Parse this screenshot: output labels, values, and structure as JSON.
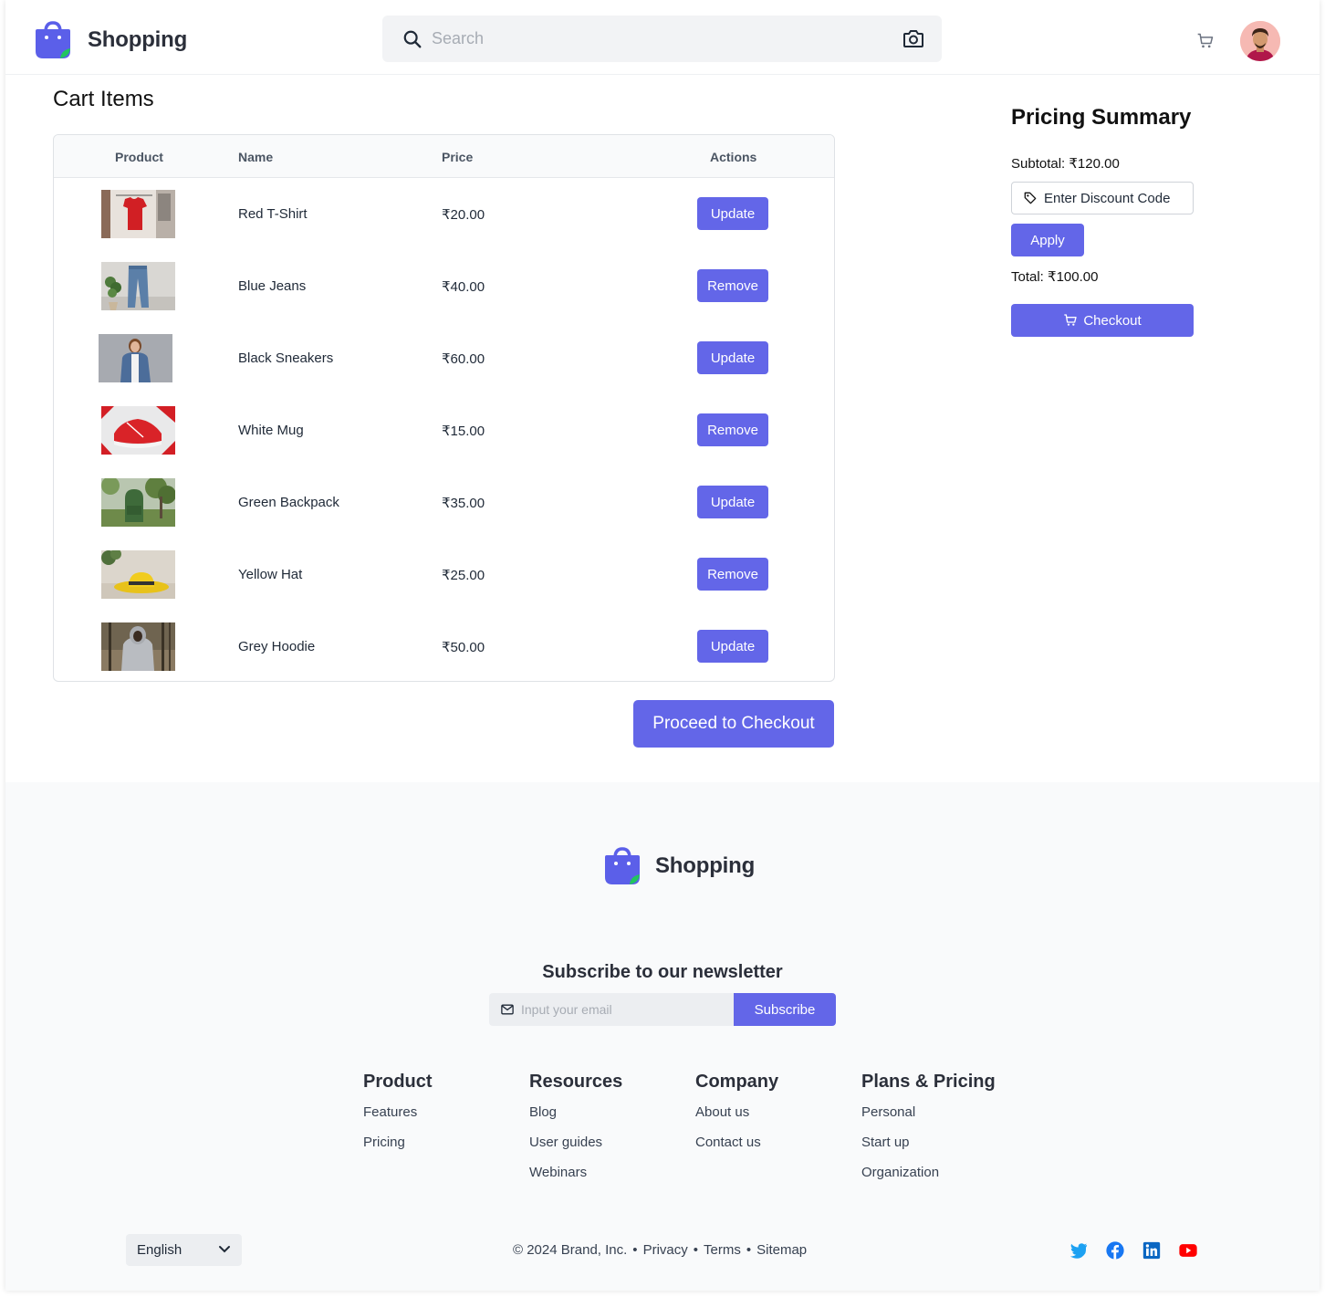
{
  "header": {
    "brand": "Shopping",
    "search_placeholder": "Search"
  },
  "cart": {
    "title": "Cart Items",
    "columns": [
      "Product",
      "Name",
      "Price",
      "Actions"
    ],
    "rows": [
      {
        "name": "Red T-Shirt",
        "price": "₹20.00",
        "action": "Update"
      },
      {
        "name": "Blue Jeans",
        "price": "₹40.00",
        "action": "Remove"
      },
      {
        "name": "Black Sneakers",
        "price": "₹60.00",
        "action": "Update"
      },
      {
        "name": "White Mug",
        "price": "₹15.00",
        "action": "Remove"
      },
      {
        "name": "Green Backpack",
        "price": "₹35.00",
        "action": "Update"
      },
      {
        "name": "Yellow Hat",
        "price": "₹25.00",
        "action": "Remove"
      },
      {
        "name": "Grey Hoodie",
        "price": "₹50.00",
        "action": "Update"
      }
    ],
    "proceed_label": "Proceed to Checkout"
  },
  "pricing": {
    "title": "Pricing Summary",
    "subtotal": "Subtotal: ₹120.00",
    "discount_placeholder": "Enter Discount Code",
    "apply_label": "Apply",
    "total": "Total: ₹100.00",
    "checkout_label": "Checkout"
  },
  "footer": {
    "brand": "Shopping",
    "newsletter_title": "Subscribe to our newsletter",
    "email_placeholder": "Input your email",
    "subscribe_label": "Subscribe",
    "columns": [
      {
        "title": "Product",
        "links": [
          "Features",
          "Pricing"
        ]
      },
      {
        "title": "Resources",
        "links": [
          "Blog",
          "User guides",
          "Webinars"
        ]
      },
      {
        "title": "Company",
        "links": [
          "About us",
          "Contact us"
        ]
      },
      {
        "title": "Plans & Pricing",
        "links": [
          "Personal",
          "Start up",
          "Organization"
        ]
      }
    ],
    "language": "English",
    "copyright": "© 2024 Brand, Inc.",
    "privacy": "Privacy",
    "terms": "Terms",
    "sitemap": "Sitemap",
    "separator": "•"
  },
  "colors": {
    "accent": "#6366e8",
    "logo_blue": "#5b5fe9",
    "logo_leaf": "#22c55e",
    "twitter": "#1da1f2",
    "facebook": "#1877f2",
    "linkedin": "#0a66c2",
    "youtube": "#ff0000"
  },
  "icons": [
    "shopping-bag-logo-icon",
    "search-icon",
    "camera-icon",
    "cart-icon",
    "tag-icon",
    "mail-icon",
    "chevron-down-icon",
    "twitter-icon",
    "facebook-icon",
    "linkedin-icon",
    "youtube-icon"
  ]
}
